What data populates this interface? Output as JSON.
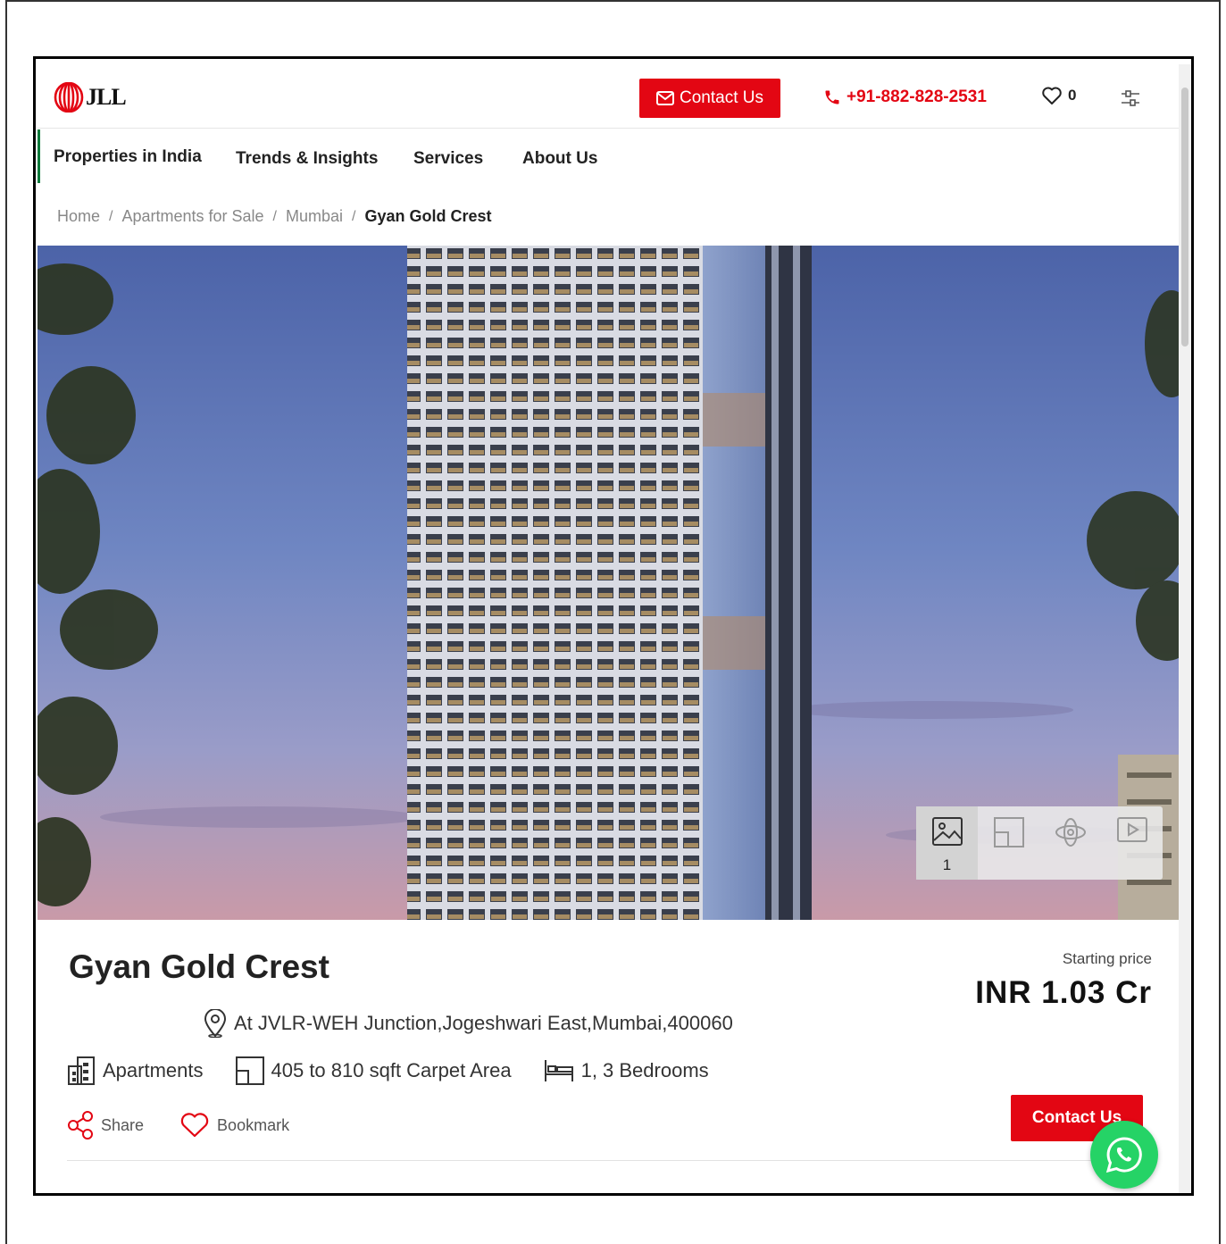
{
  "header": {
    "logo_text": "JLL",
    "contact_label": "Contact Us",
    "phone": "+91-882-828-2531",
    "wishlist_count": "0"
  },
  "nav": {
    "items": [
      "Properties in India",
      "Trends & Insights",
      "Services",
      "About Us"
    ]
  },
  "breadcrumb": {
    "items": [
      "Home",
      "Apartments for Sale",
      "Mumbai"
    ],
    "separator": "/",
    "current": "Gyan Gold Crest"
  },
  "gallery": {
    "image_count": "1",
    "tabs": [
      "image-icon",
      "floor-plan-icon",
      "360-view-icon",
      "video-icon"
    ]
  },
  "property": {
    "name": "Gyan Gold Crest",
    "address": "At JVLR-WEH Junction,Jogeshwari East,Mumbai,400060",
    "type": "Apartments",
    "area": "405 to 810 sqft Carpet Area",
    "bedrooms": "1, 3 Bedrooms",
    "price_label": "Starting price",
    "price": "INR 1.03 Cr"
  },
  "actions": {
    "share": "Share",
    "bookmark": "Bookmark",
    "contact": "Contact Us"
  },
  "colors": {
    "brand_red": "#e30613",
    "whatsapp_green": "#25d366"
  }
}
